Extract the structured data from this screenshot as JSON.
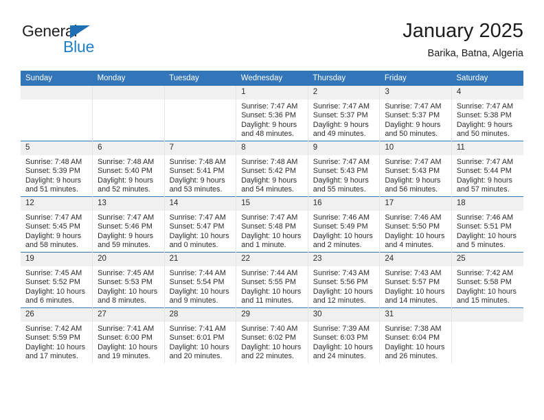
{
  "brand": {
    "name_part1": "General",
    "name_part2": "Blue",
    "triangle_icon": "triangle-icon",
    "accent_color": "#1f7fc4"
  },
  "header": {
    "month_title": "January 2025",
    "location": "Barika, Batna, Algeria"
  },
  "colors": {
    "header_blue": "#3275b8",
    "daynum_strip": "#f0f0f0",
    "text": "#2b2b2b"
  },
  "calendar": {
    "weekday_headers": [
      "Sunday",
      "Monday",
      "Tuesday",
      "Wednesday",
      "Thursday",
      "Friday",
      "Saturday"
    ],
    "weeks": [
      [
        {
          "day": "",
          "empty": true
        },
        {
          "day": "",
          "empty": true
        },
        {
          "day": "",
          "empty": true
        },
        {
          "day": "1",
          "sunrise": "Sunrise: 7:47 AM",
          "sunset": "Sunset: 5:36 PM",
          "daylight1": "Daylight: 9 hours",
          "daylight2": "and 48 minutes."
        },
        {
          "day": "2",
          "sunrise": "Sunrise: 7:47 AM",
          "sunset": "Sunset: 5:37 PM",
          "daylight1": "Daylight: 9 hours",
          "daylight2": "and 49 minutes."
        },
        {
          "day": "3",
          "sunrise": "Sunrise: 7:47 AM",
          "sunset": "Sunset: 5:37 PM",
          "daylight1": "Daylight: 9 hours",
          "daylight2": "and 50 minutes."
        },
        {
          "day": "4",
          "sunrise": "Sunrise: 7:47 AM",
          "sunset": "Sunset: 5:38 PM",
          "daylight1": "Daylight: 9 hours",
          "daylight2": "and 50 minutes."
        }
      ],
      [
        {
          "day": "5",
          "sunrise": "Sunrise: 7:48 AM",
          "sunset": "Sunset: 5:39 PM",
          "daylight1": "Daylight: 9 hours",
          "daylight2": "and 51 minutes."
        },
        {
          "day": "6",
          "sunrise": "Sunrise: 7:48 AM",
          "sunset": "Sunset: 5:40 PM",
          "daylight1": "Daylight: 9 hours",
          "daylight2": "and 52 minutes."
        },
        {
          "day": "7",
          "sunrise": "Sunrise: 7:48 AM",
          "sunset": "Sunset: 5:41 PM",
          "daylight1": "Daylight: 9 hours",
          "daylight2": "and 53 minutes."
        },
        {
          "day": "8",
          "sunrise": "Sunrise: 7:48 AM",
          "sunset": "Sunset: 5:42 PM",
          "daylight1": "Daylight: 9 hours",
          "daylight2": "and 54 minutes."
        },
        {
          "day": "9",
          "sunrise": "Sunrise: 7:47 AM",
          "sunset": "Sunset: 5:43 PM",
          "daylight1": "Daylight: 9 hours",
          "daylight2": "and 55 minutes."
        },
        {
          "day": "10",
          "sunrise": "Sunrise: 7:47 AM",
          "sunset": "Sunset: 5:43 PM",
          "daylight1": "Daylight: 9 hours",
          "daylight2": "and 56 minutes."
        },
        {
          "day": "11",
          "sunrise": "Sunrise: 7:47 AM",
          "sunset": "Sunset: 5:44 PM",
          "daylight1": "Daylight: 9 hours",
          "daylight2": "and 57 minutes."
        }
      ],
      [
        {
          "day": "12",
          "sunrise": "Sunrise: 7:47 AM",
          "sunset": "Sunset: 5:45 PM",
          "daylight1": "Daylight: 9 hours",
          "daylight2": "and 58 minutes."
        },
        {
          "day": "13",
          "sunrise": "Sunrise: 7:47 AM",
          "sunset": "Sunset: 5:46 PM",
          "daylight1": "Daylight: 9 hours",
          "daylight2": "and 59 minutes."
        },
        {
          "day": "14",
          "sunrise": "Sunrise: 7:47 AM",
          "sunset": "Sunset: 5:47 PM",
          "daylight1": "Daylight: 10 hours",
          "daylight2": "and 0 minutes."
        },
        {
          "day": "15",
          "sunrise": "Sunrise: 7:47 AM",
          "sunset": "Sunset: 5:48 PM",
          "daylight1": "Daylight: 10 hours",
          "daylight2": "and 1 minute."
        },
        {
          "day": "16",
          "sunrise": "Sunrise: 7:46 AM",
          "sunset": "Sunset: 5:49 PM",
          "daylight1": "Daylight: 10 hours",
          "daylight2": "and 2 minutes."
        },
        {
          "day": "17",
          "sunrise": "Sunrise: 7:46 AM",
          "sunset": "Sunset: 5:50 PM",
          "daylight1": "Daylight: 10 hours",
          "daylight2": "and 4 minutes."
        },
        {
          "day": "18",
          "sunrise": "Sunrise: 7:46 AM",
          "sunset": "Sunset: 5:51 PM",
          "daylight1": "Daylight: 10 hours",
          "daylight2": "and 5 minutes."
        }
      ],
      [
        {
          "day": "19",
          "sunrise": "Sunrise: 7:45 AM",
          "sunset": "Sunset: 5:52 PM",
          "daylight1": "Daylight: 10 hours",
          "daylight2": "and 6 minutes."
        },
        {
          "day": "20",
          "sunrise": "Sunrise: 7:45 AM",
          "sunset": "Sunset: 5:53 PM",
          "daylight1": "Daylight: 10 hours",
          "daylight2": "and 8 minutes."
        },
        {
          "day": "21",
          "sunrise": "Sunrise: 7:44 AM",
          "sunset": "Sunset: 5:54 PM",
          "daylight1": "Daylight: 10 hours",
          "daylight2": "and 9 minutes."
        },
        {
          "day": "22",
          "sunrise": "Sunrise: 7:44 AM",
          "sunset": "Sunset: 5:55 PM",
          "daylight1": "Daylight: 10 hours",
          "daylight2": "and 11 minutes."
        },
        {
          "day": "23",
          "sunrise": "Sunrise: 7:43 AM",
          "sunset": "Sunset: 5:56 PM",
          "daylight1": "Daylight: 10 hours",
          "daylight2": "and 12 minutes."
        },
        {
          "day": "24",
          "sunrise": "Sunrise: 7:43 AM",
          "sunset": "Sunset: 5:57 PM",
          "daylight1": "Daylight: 10 hours",
          "daylight2": "and 14 minutes."
        },
        {
          "day": "25",
          "sunrise": "Sunrise: 7:42 AM",
          "sunset": "Sunset: 5:58 PM",
          "daylight1": "Daylight: 10 hours",
          "daylight2": "and 15 minutes."
        }
      ],
      [
        {
          "day": "26",
          "sunrise": "Sunrise: 7:42 AM",
          "sunset": "Sunset: 5:59 PM",
          "daylight1": "Daylight: 10 hours",
          "daylight2": "and 17 minutes."
        },
        {
          "day": "27",
          "sunrise": "Sunrise: 7:41 AM",
          "sunset": "Sunset: 6:00 PM",
          "daylight1": "Daylight: 10 hours",
          "daylight2": "and 19 minutes."
        },
        {
          "day": "28",
          "sunrise": "Sunrise: 7:41 AM",
          "sunset": "Sunset: 6:01 PM",
          "daylight1": "Daylight: 10 hours",
          "daylight2": "and 20 minutes."
        },
        {
          "day": "29",
          "sunrise": "Sunrise: 7:40 AM",
          "sunset": "Sunset: 6:02 PM",
          "daylight1": "Daylight: 10 hours",
          "daylight2": "and 22 minutes."
        },
        {
          "day": "30",
          "sunrise": "Sunrise: 7:39 AM",
          "sunset": "Sunset: 6:03 PM",
          "daylight1": "Daylight: 10 hours",
          "daylight2": "and 24 minutes."
        },
        {
          "day": "31",
          "sunrise": "Sunrise: 7:38 AM",
          "sunset": "Sunset: 6:04 PM",
          "daylight1": "Daylight: 10 hours",
          "daylight2": "and 26 minutes."
        },
        {
          "day": "",
          "empty": true
        }
      ]
    ]
  }
}
